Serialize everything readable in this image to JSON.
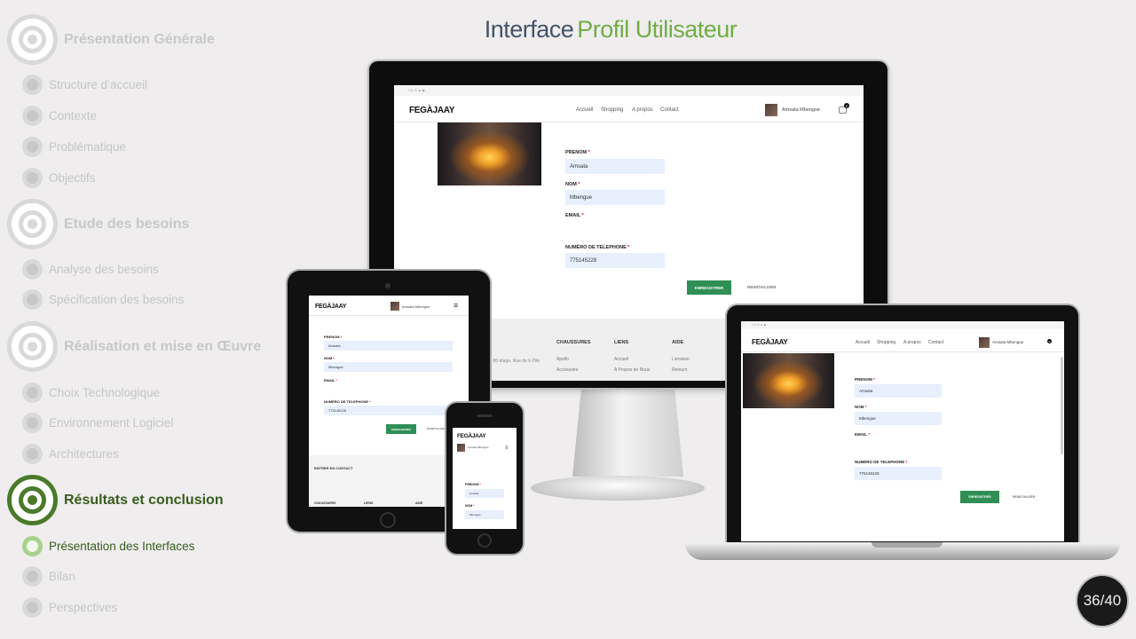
{
  "slide": {
    "title_part1": "Interface",
    "title_part2": "Profil Utilisateur",
    "page_counter": "36/40"
  },
  "sidebar": {
    "sections": [
      {
        "label": "Présentation Générale",
        "items": [
          "Structure  d’accueil",
          "Contexte",
          "Problématique",
          "Objectifs"
        ]
      },
      {
        "label": "Etude des besoins",
        "items": [
          "Analyse des besoins",
          "Spécification des besoins"
        ]
      },
      {
        "label": "Réalisation et mise en Œuvre",
        "items": [
          "Choix Technologique",
          "Environnement  Logiciel",
          "Architectures"
        ]
      },
      {
        "label": "Résultats et conclusion",
        "items": [
          "Présentation des Interfaces",
          "Bilan",
          "Perspectives"
        ]
      }
    ],
    "active_section": "Résultats et conclusion",
    "active_item": "Présentation des Interfaces"
  },
  "website": {
    "logo": "FEGÀJAAY",
    "nav": [
      "Accueil",
      "Shopping",
      "A propos",
      "Contact"
    ],
    "user": "Amsata Mbengue",
    "cart_count": "0",
    "form": {
      "prenom_label": "PRENOM",
      "prenom_value": "Amsata",
      "nom_label": "NOM",
      "nom_value": "Mbengue",
      "email_label": "EMAIL",
      "phone_label": "NUMÉRO DE TELEPHONE",
      "phone_value": "775145228",
      "save_button": "ENREGISTRER",
      "reset_button": "REINITIALISER",
      "required_mark": "*"
    },
    "footer": {
      "columns": [
        "CHAUSSURES",
        "LIENS",
        "AIDE"
      ],
      "address": "... 80 étage, Rue de 6 Pitè",
      "col_chaussures": [
        "Apollo",
        "Accessoire"
      ],
      "col_liens": [
        "Accueil",
        "A Propos de Nous"
      ],
      "col_aide": [
        "Livraison",
        "Retours"
      ],
      "contact_heading": "ENTRER EN CONTACT"
    }
  }
}
